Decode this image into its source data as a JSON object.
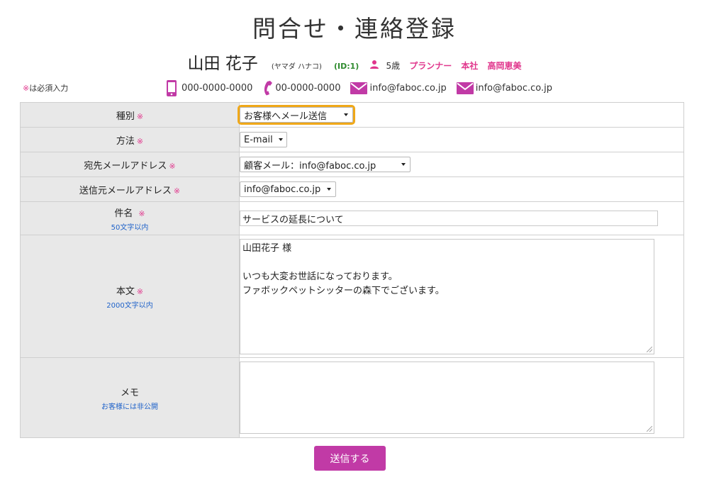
{
  "page": {
    "title": "問合せ・連絡登録"
  },
  "customer": {
    "name": "山田 花子",
    "kana": "(ヤマダ ハナコ)",
    "id": "(ID:1)",
    "age": "5歳",
    "planner_label": "プランナー",
    "branch": "本社",
    "staff": "高岡恵美"
  },
  "required_note": {
    "mark": "※",
    "text": "は必須入力"
  },
  "contact": {
    "mobile": "000-0000-0000",
    "phone": "00-0000-0000",
    "email1": "info@faboc.co.jp",
    "email2": "info@faboc.co.jp"
  },
  "form": {
    "required_mark": "※",
    "type": {
      "label": "種別",
      "value": "お客様へメール送信"
    },
    "method": {
      "label": "方法",
      "value": "E-mail"
    },
    "to_address": {
      "label": "宛先メールアドレス",
      "value": "顧客メール：info@faboc.co.jp"
    },
    "from_address": {
      "label": "送信元メールアドレス",
      "value": "info@faboc.co.jp"
    },
    "subject": {
      "label": "件名",
      "limit": "50文字以内",
      "value": "サービスの延長について"
    },
    "body": {
      "label": "本文",
      "limit": "2000文字以内",
      "lines": [
        "山田花子 様",
        "",
        "いつも大変お世話になっております。",
        "ファボックペットシッターの森下でございます。"
      ]
    },
    "memo": {
      "label": "メモ",
      "note": "お客様には非公開",
      "value": ""
    }
  },
  "submit": {
    "label": "送信する"
  },
  "colors": {
    "accent": "#e0368c",
    "button": "#c13aa6",
    "focus": "#f0a818",
    "link": "#1f62c9"
  }
}
